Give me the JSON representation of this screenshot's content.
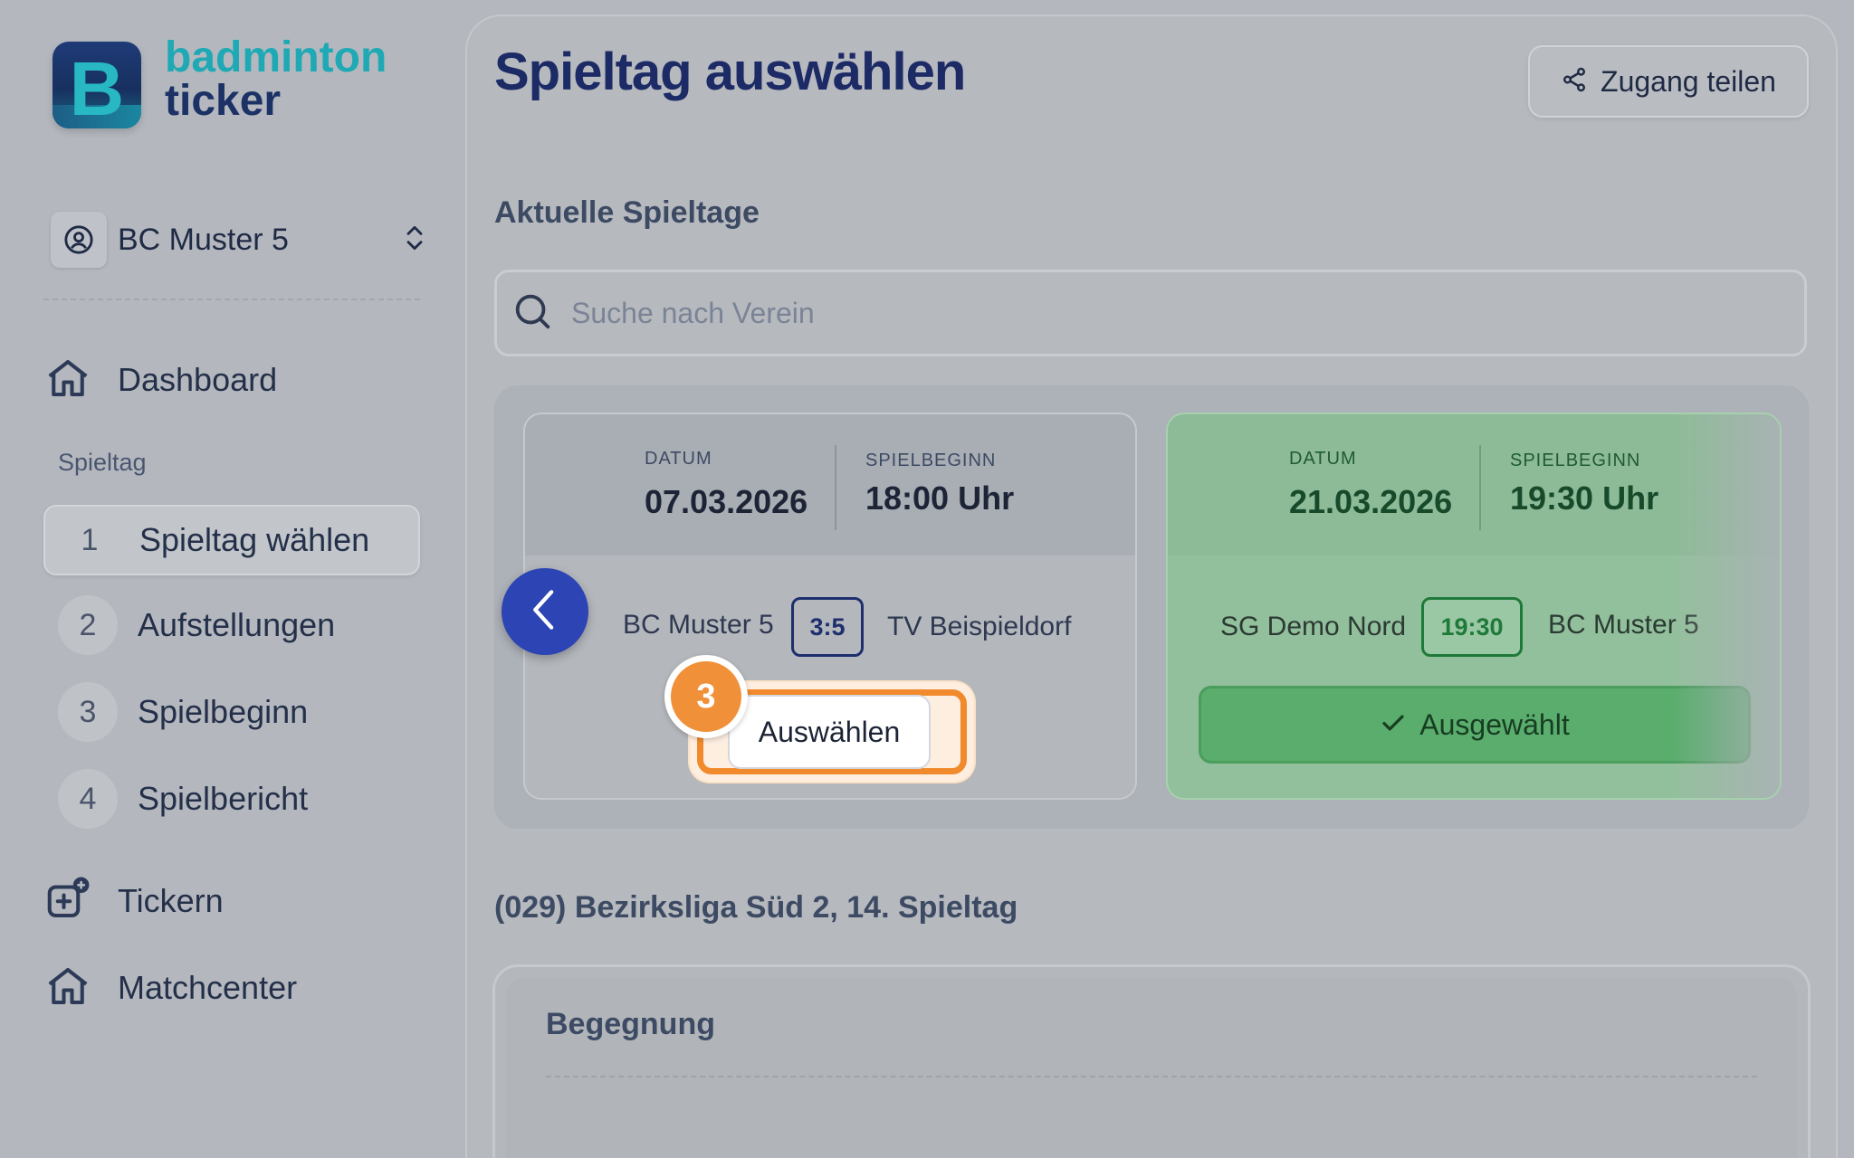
{
  "brand": {
    "line1": "badminton",
    "line2": "ticker",
    "logo_letter": "B"
  },
  "team_selector": {
    "name": "BC Muster 5"
  },
  "nav": {
    "dashboard": "Dashboard",
    "section_label": "Spieltag",
    "steps": [
      {
        "num": "1",
        "label": "Spieltag wählen",
        "active": true
      },
      {
        "num": "2",
        "label": "Aufstellungen"
      },
      {
        "num": "3",
        "label": "Spielbeginn"
      },
      {
        "num": "4",
        "label": "Spielbericht"
      }
    ],
    "tickern": "Tickern",
    "matchcenter": "Matchcenter"
  },
  "header": {
    "title": "Spieltag auswählen",
    "share_label": "Zugang teilen"
  },
  "current": {
    "heading": "Aktuelle Spieltage",
    "search_placeholder": "Suche nach Verein"
  },
  "cards": [
    {
      "date_label": "DATUM",
      "date": "07.03.2026",
      "start_label": "SPIELBEGINN",
      "start": "18:00 Uhr",
      "home": "BC Muster 5",
      "score": "3:5",
      "away": "TV Beispieldorf",
      "button": "Auswählen",
      "step_badge": "3"
    },
    {
      "date_label": "DATUM",
      "date": "21.03.2026",
      "start_label": "SPIELBEGINN",
      "start": "19:30 Uhr",
      "home": "SG Demo Nord",
      "time": "19:30",
      "away": "BC Muster 5",
      "button": "Ausgewählt"
    }
  ],
  "league": {
    "heading": "(029) Bezirksliga Süd 2, 14. Spieltag",
    "panel_heading": "Begegnung"
  },
  "colors": {
    "accent": "#2c44b4",
    "highlight": "#f08a2c",
    "selected": "#5aad6d",
    "title": "#1c2a66"
  }
}
